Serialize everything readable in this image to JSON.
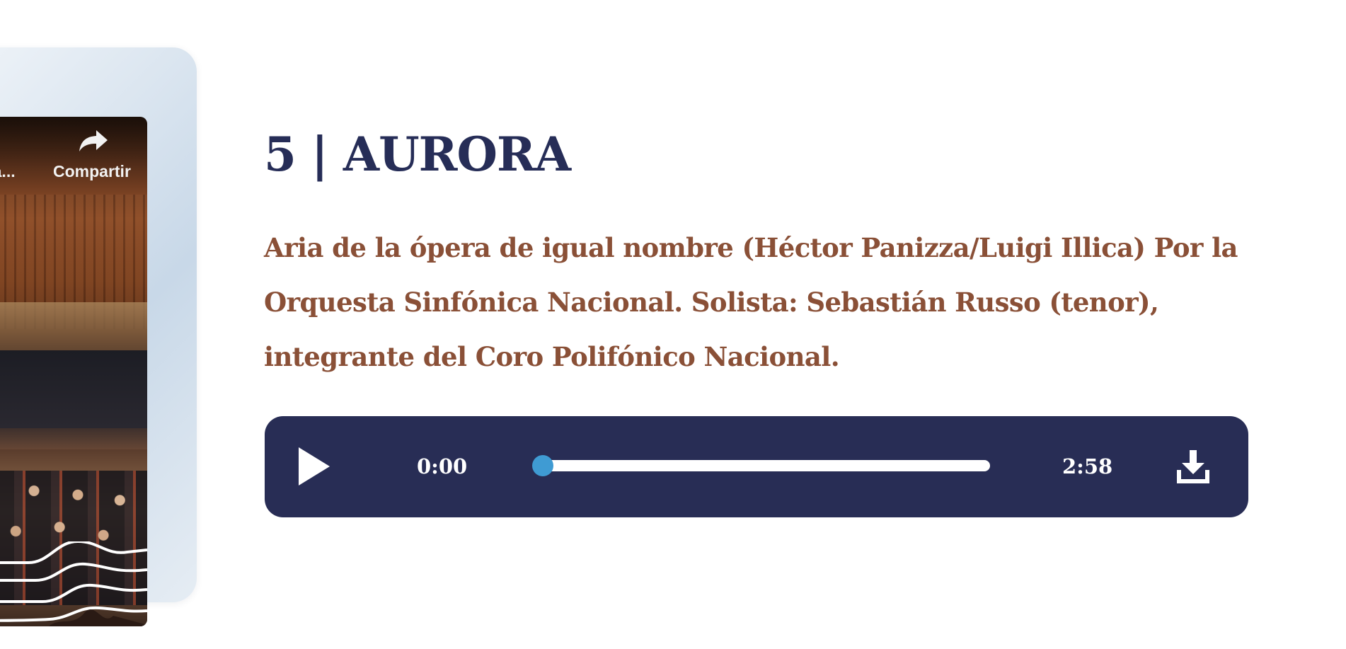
{
  "video": {
    "more_label": "ás ta...",
    "share_label": "Compartir",
    "more_icon": "clock-icon",
    "share_icon": "share-arrow-icon"
  },
  "track": {
    "title": "5 | AURORA",
    "description": "Aria de la ópera de igual nombre (Héctor Panizza/Luigi Illica) Por la Orquesta Sinfónica Nacional. Solista: Sebastián Russo (tenor), integrante del Coro Polifónico Nacional."
  },
  "player": {
    "current_time": "0:00",
    "total_time": "2:58",
    "progress": 0,
    "play_icon": "play-icon",
    "download_icon": "download-icon",
    "colors": {
      "background": "#282d55",
      "accent": "#3f9bd3",
      "track": "#ffffff"
    }
  },
  "colors": {
    "title": "#262d57",
    "description": "#8a5037"
  }
}
